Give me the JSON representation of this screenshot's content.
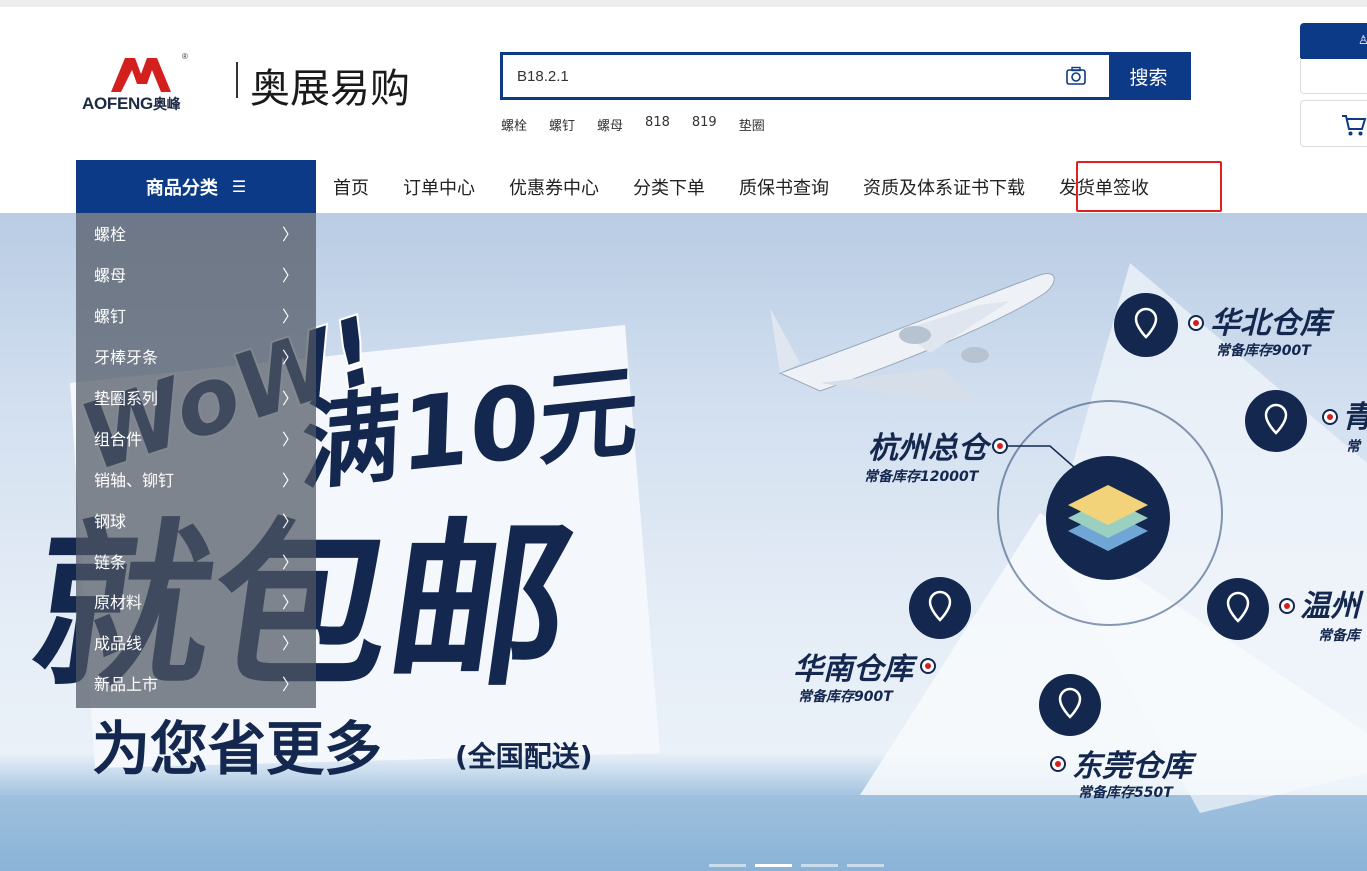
{
  "logo": {
    "brand_en": "AOFENG",
    "brand_en_cn": "奥峰",
    "registered": "®",
    "site_name": "奥展易购"
  },
  "search": {
    "value": "B18.2.1",
    "button_label": "搜索",
    "hotwords": [
      "螺栓",
      "螺钉",
      "螺母",
      "818",
      "819",
      "垫圈"
    ]
  },
  "nav": {
    "category_title": "商品分类",
    "items": [
      "首页",
      "订单中心",
      "优惠券中心",
      "分类下单",
      "质保书查询",
      "资质及体系证书下载",
      "发货单签收"
    ]
  },
  "categories": [
    "螺栓",
    "螺母",
    "螺钉",
    "牙棒牙条",
    "垫圈系列",
    "组合件",
    "销轴、铆钉",
    "钢球",
    "链条",
    "原材料",
    "成品线",
    "新品上市"
  ],
  "banner": {
    "wow": "WoW!",
    "headline_top": "满10元",
    "headline_main": "就包邮",
    "slogan": "为您省更多",
    "slogan_sub": "(全国配送)",
    "warehouses": [
      {
        "name": "华北仓库",
        "stock": "常备库存900T"
      },
      {
        "name": "青",
        "stock": "常"
      },
      {
        "name": "杭州总仓",
        "stock": "常备库存12000T"
      },
      {
        "name": "华南仓库",
        "stock": "常备库存900T"
      },
      {
        "name": "温州",
        "stock": "常备库"
      },
      {
        "name": "东莞仓库",
        "stock": "常备库存550T"
      }
    ]
  },
  "colors": {
    "primary": "#0d3a86",
    "highlight": "#e02020",
    "banner_navy": "#14284f"
  },
  "slider": {
    "count": 4,
    "active": 1
  }
}
